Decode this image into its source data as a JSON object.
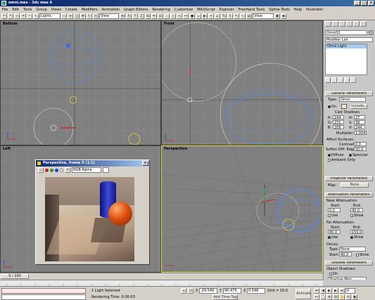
{
  "window": {
    "title": "omni.max - 3ds max 4"
  },
  "menu": [
    "File",
    "Edit",
    "Tools",
    "Group",
    "Views",
    "Create",
    "Modifiers",
    "Animation",
    "Graph Editors",
    "Rendering",
    "Customize",
    "MAXScript",
    "Explorer",
    "FreeHand Tools",
    "Spline Tools",
    "Help",
    "Illustrate!"
  ],
  "toolbar": {
    "selection_filter": "Lights",
    "ref_coord": "View",
    "ref_coord2": "View"
  },
  "viewports": {
    "top_left": "Bottom",
    "top_right": "Front",
    "bottom_left": "Left",
    "bottom_right": "Perspective"
  },
  "panel": {
    "object_name": "Omni02",
    "modifier_list": "Modifier List",
    "stack_item": "Omni Light",
    "general_parameters": "General Parameters",
    "type_label": "Type:",
    "type_value": "Omni",
    "on_label": "On",
    "include_button": "Include...",
    "cast_shadows": "Cast Shadows",
    "color_r_label": "R:",
    "color_r": "244",
    "color_g_label": "G:",
    "color_g": "231",
    "color_b_label": "B:",
    "color_b": "206",
    "color_h_label": "H:",
    "color_h": "27",
    "color_s_label": "S:",
    "color_s": "39",
    "color_v_label": "V:",
    "color_v": "244",
    "multiplier_label": "Multiplier:",
    "multiplier": "1.004",
    "affect_surfaces": "Affect Surfaces:",
    "contrast_label": "Contrast:",
    "contrast": "0.0",
    "soften_label": "Soften Diff. Edge:",
    "soften": "50.0",
    "diffuse": "Diffuse",
    "specular": "Specular",
    "ambient_only": "Ambient Only",
    "projector_parameters": "Projector Parameters",
    "map_label": "Map:",
    "map_value": "None",
    "attenuation_parameters": "Attenuation Parameters",
    "near_attenuation": "Near Attenuation:",
    "start_label": "Start:",
    "end_label": "End:",
    "near_start": "0.0",
    "near_end": "40.0",
    "use_label": "Use",
    "show_label": "Show",
    "far_attenuation": "Far Attenuation:",
    "far_start": "80.0",
    "far_end": "150.0",
    "decay": "Decay:",
    "decay_type_label": "Type:",
    "decay_type": "None",
    "decay_start_label": "Start:",
    "decay_start": "40.0",
    "shadow_parameters": "Shadow Parameters",
    "object_shadows": "Object Shadows:",
    "shadow_on": "On",
    "shadow_type": "Shadow Map"
  },
  "render_window": {
    "title": "Perspective, frame 0 (1:1)",
    "channel": "RGB Alpha"
  },
  "timeline": {
    "slider": "0 / 100"
  },
  "status": {
    "selection": "1 Light Selected",
    "rendering_time": "Rendering Time: 0:00:03",
    "x_label": "X",
    "x": "-29.549",
    "y_label": "Y",
    "y": "90.475",
    "z_label": "Z",
    "z": "0.598",
    "grid": "Grid = 10.0",
    "add_time_tag": "Add Time Tag",
    "animate": "Animate",
    "frame": "0"
  }
}
